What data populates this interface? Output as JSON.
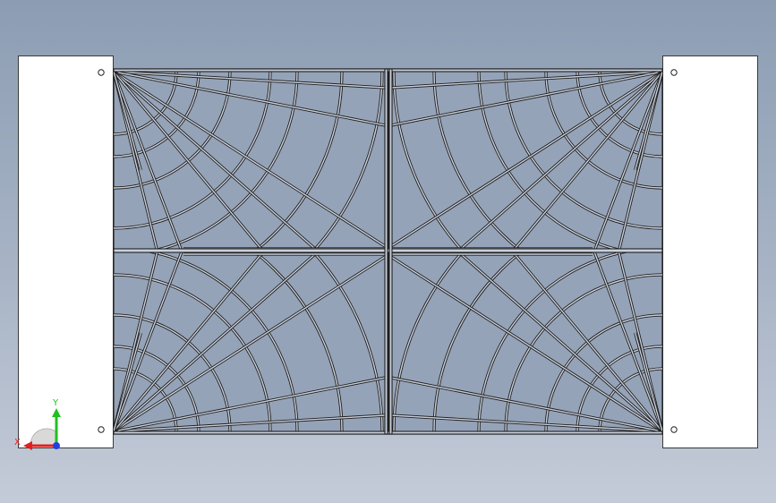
{
  "viewport": {
    "background_top": "#8c9db3",
    "background_bottom": "#c4cbd8",
    "model_face_color": "#95a3b8",
    "edge_color": "#1e1e1e"
  },
  "triad": {
    "x_label": "X",
    "y_label": "Y",
    "x_color": "#e02020",
    "y_color": "#20c020",
    "z_color": "#2040e0"
  }
}
